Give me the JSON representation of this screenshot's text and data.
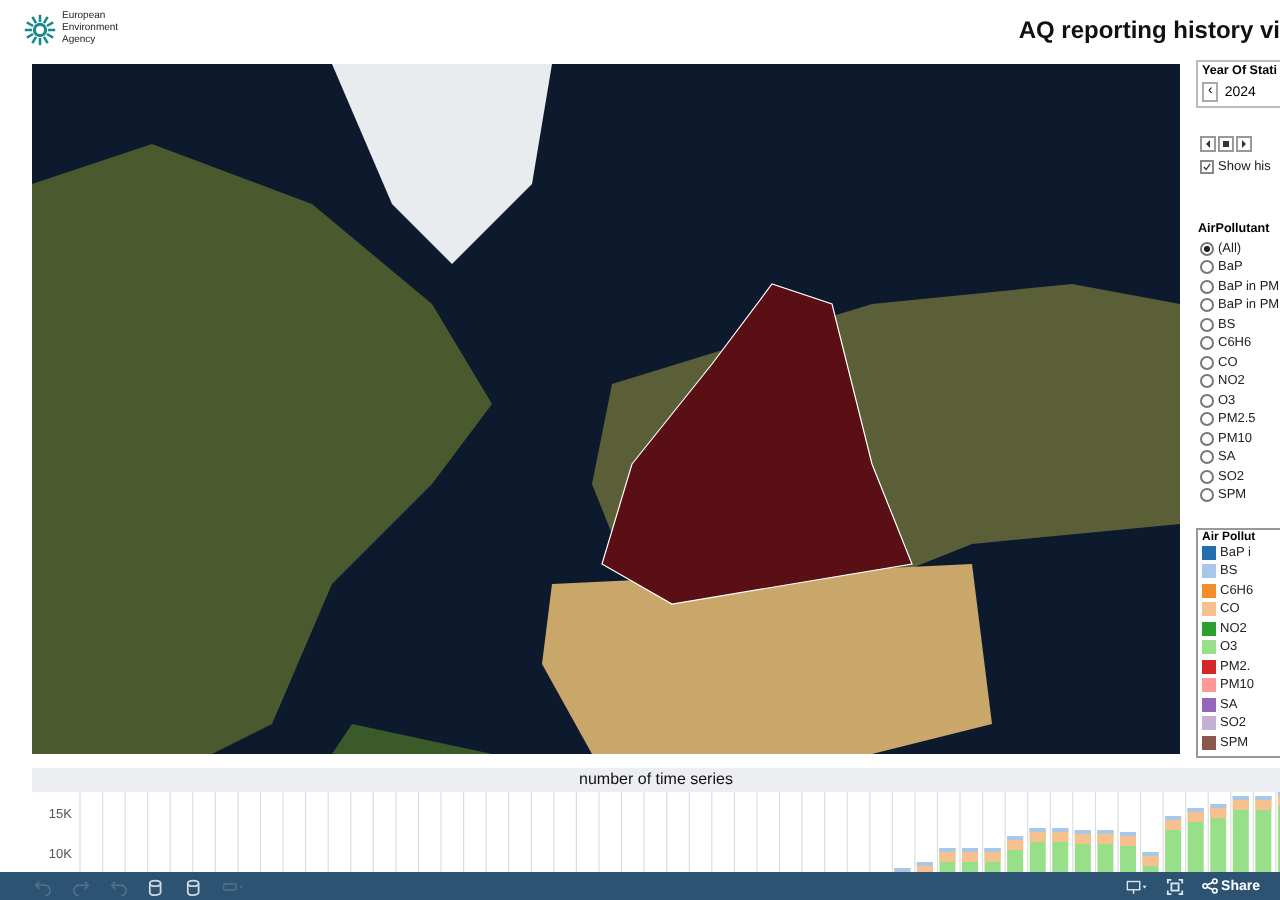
{
  "header": {
    "logo_text": "European Environment Agency",
    "title": "AQ reporting history vi"
  },
  "year_filter": {
    "label": "Year Of Stati",
    "prev": "‹",
    "value": "2024",
    "show_history": {
      "label": "Show his",
      "checked": true
    }
  },
  "pollutant_filter": {
    "title": "AirPollutant",
    "options": [
      {
        "label": "(All)",
        "selected": true
      },
      {
        "label": "BaP",
        "selected": false
      },
      {
        "label": "BaP in PM",
        "selected": false
      },
      {
        "label": "BaP in PM",
        "selected": false
      },
      {
        "label": "BS",
        "selected": false
      },
      {
        "label": "C6H6",
        "selected": false
      },
      {
        "label": "CO",
        "selected": false
      },
      {
        "label": "NO2",
        "selected": false
      },
      {
        "label": "O3",
        "selected": false
      },
      {
        "label": "PM2.5",
        "selected": false
      },
      {
        "label": "PM10",
        "selected": false
      },
      {
        "label": "SA",
        "selected": false
      },
      {
        "label": "SO2",
        "selected": false
      },
      {
        "label": "SPM",
        "selected": false
      }
    ]
  },
  "legend": {
    "title": "Air Pollut",
    "items": [
      {
        "label": "BaP i",
        "color": "#1f6fb0"
      },
      {
        "label": "BS",
        "color": "#a9c7e8"
      },
      {
        "label": "C6H6",
        "color": "#f28e2b"
      },
      {
        "label": "CO",
        "color": "#f7c08f"
      },
      {
        "label": "NO2",
        "color": "#2ca02c"
      },
      {
        "label": "O3",
        "color": "#98df8a"
      },
      {
        "label": "PM2.",
        "color": "#d62728"
      },
      {
        "label": "PM10",
        "color": "#ff9896"
      },
      {
        "label": "SA",
        "color": "#9467bd"
      },
      {
        "label": "SO2",
        "color": "#c5b0d5"
      },
      {
        "label": "SPM",
        "color": "#8c564b"
      }
    ]
  },
  "chart": {
    "title": "number of time series",
    "ytick_labels": [
      "15K",
      "10K"
    ]
  },
  "toolbar": {
    "share": "Share"
  }
}
